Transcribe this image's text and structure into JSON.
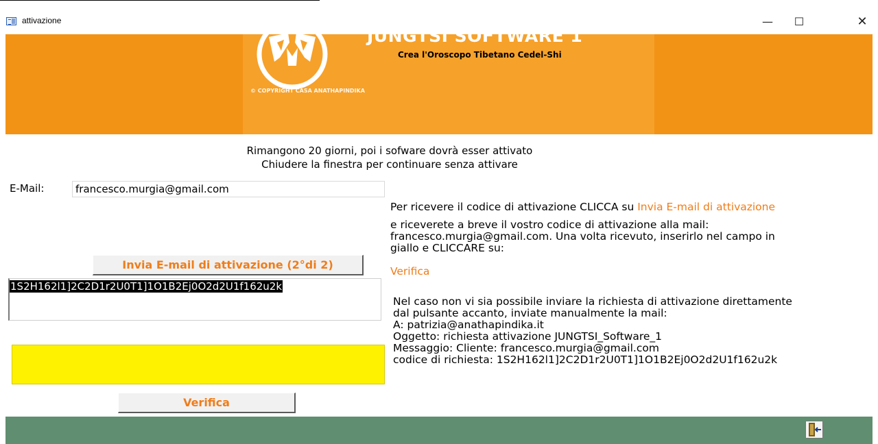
{
  "window": {
    "title": "attivazione",
    "controls": {
      "minimize": "—",
      "maximize": "☐",
      "close": "✕"
    },
    "icon": "form-icon"
  },
  "banner": {
    "brand_title": "JUNGTSI SOFTWARE 1",
    "brand_subtitle": "Crea l'Oroscopo Tibetano Cedel-Shi",
    "copyright": "© COPYRIGHT CASA ANATHAPINDIKA",
    "logo": "tibetan-logo-icon",
    "colors": {
      "orange": "#f39315",
      "orange_light": "#f6a12a"
    }
  },
  "notice": {
    "line1": "Rimangono 20 giorni, poi i sofware dovrà esser attivato",
    "line2": "Chiudere la finestra per continuare senza attivare"
  },
  "form": {
    "email_label": "E-Mail:",
    "email_value": "francesco.murgia@gmail.com",
    "send_button": "Invia E-mail di attivazione  (2°di 2)",
    "request_code": "1S2H162l1]2C2D1r2U0T1]1O1B2Ej0O2d2U1f162u2k",
    "activation_code_value": "",
    "verify_button": "Verifica",
    "colors": {
      "yellow": "#fff200",
      "accent": "#ef7d1a"
    }
  },
  "instructions": {
    "line1_prefix": "Per ricevere il codice di attivazione CLICCA su",
    "line1_link": "Invia E-mail di attivazione",
    "line2": "e riceverete a breve il vostro codice di attivazione alla mail:",
    "line3": "francesco.murgia@gmail.com. Una volta ricevuto, inserirlo nel campo in",
    "line4": "giallo e CLICCARE su:",
    "line5_link": "Verifica"
  },
  "manual": {
    "line1": "Nel caso non vi sia possibile inviare la richiesta di attivazione direttamente",
    "line2": "dal pulsante accanto, inviate manualmente la mail:",
    "line3": "A: patrizia@anathapindika.it",
    "line4": "Oggetto: richiesta attivazione JUNGTSI_Software_1",
    "line5": "Messaggio: Cliente: francesco.murgia@gmail.com",
    "line6": "codice di richiesta: 1S2H162l1]2C2D1r2U0T1]1O1B2Ej0O2d2U1f162u2k"
  },
  "footer": {
    "exit_icon": "exit-door-icon",
    "color": "#5f8f70"
  }
}
